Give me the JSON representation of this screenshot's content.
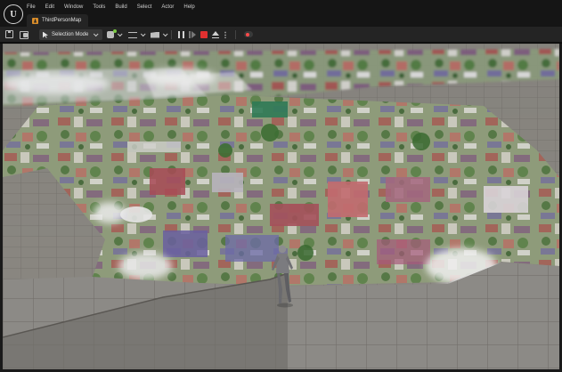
{
  "app": {
    "logo": "U",
    "menu": [
      "File",
      "Edit",
      "Window",
      "Tools",
      "Build",
      "Select",
      "Actor",
      "Help"
    ],
    "tab_title": "ThirdPersonMap"
  },
  "toolbar": {
    "save_icon": "save-icon",
    "browse_icon": "content-browser-icon",
    "selection_mode_label": "Selection Mode",
    "quick_add_icon": "quick-add-icon",
    "blueprint_icon": "blueprint-icon",
    "cinematics_icon": "cinematics-icon",
    "play_controls": [
      "pause-icon",
      "skip-frame-icon",
      "stop-icon",
      "eject-icon"
    ],
    "record_icon": "record-icon"
  },
  "viewport": {
    "scene": "3D campus map with third-person character on grid floor",
    "stop_color": "#e03030",
    "accent_tab_color": "#d98d2a"
  }
}
